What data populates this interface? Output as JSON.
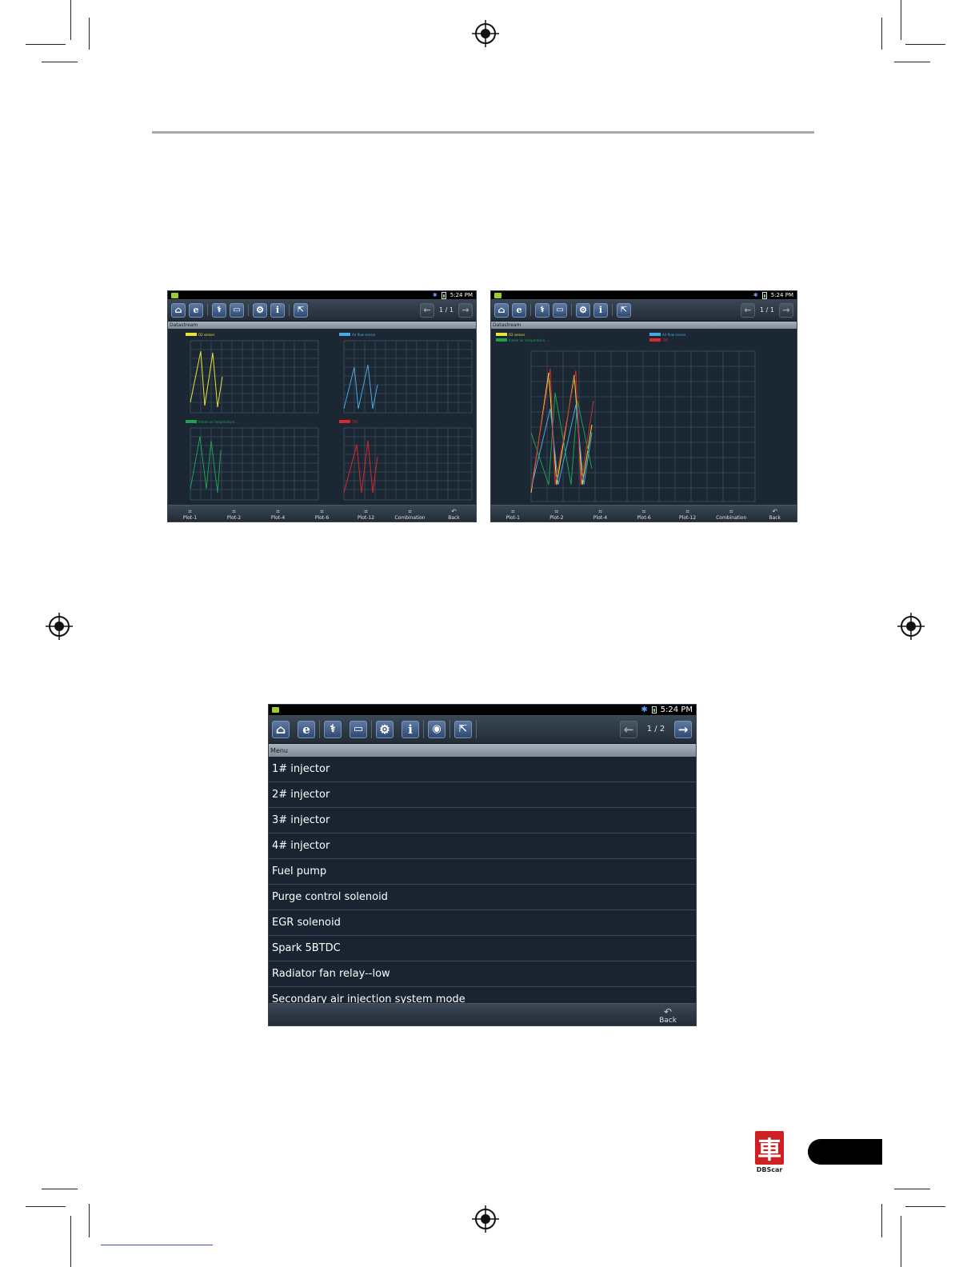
{
  "screen1": {
    "time": "5:24 PM",
    "page": "1 / 1",
    "title": "Datastream",
    "legends": [
      "O2 sensor",
      "Air flow sensor",
      "Intake air temperature...",
      "TPS"
    ],
    "bottom_buttons": [
      "Plot-1",
      "Plot-2",
      "Plot-4",
      "Plot-6",
      "Plot-12",
      "Combination",
      "Back"
    ]
  },
  "screen2": {
    "time": "5:24 PM",
    "page": "1 / 1",
    "title": "Datastream",
    "legends": [
      "O2 sensor",
      "Intake air temperature...",
      "Air flow sensor",
      "TPS"
    ],
    "bottom_buttons": [
      "Plot-1",
      "Plot-2",
      "Plot-4",
      "Plot-6",
      "Plot-12",
      "Combination",
      "Back"
    ]
  },
  "screen3": {
    "time": "5:24 PM",
    "page": "1 / 2",
    "title": "Menu",
    "items": [
      "1# injector",
      "2# injector",
      "3# injector",
      "4# injector",
      "Fuel pump",
      "Purge control solenoid",
      "EGR solenoid",
      "Spark 5BTDC",
      "Radiator fan relay--low",
      "Secondary air injection system mode"
    ],
    "back_label": "Back"
  },
  "brand": {
    "logo_char": "車",
    "name": "DBScar"
  },
  "colors": {
    "yellow": "#e8e23a",
    "blue": "#4aa8e0",
    "green": "#1fa050",
    "red": "#d8282c",
    "grid": "#4f6b80"
  },
  "icons": [
    "home-icon",
    "browser-icon",
    "diagnose-icon",
    "message-icon",
    "settings-icon",
    "info-icon",
    "camera-icon",
    "exit-icon",
    "arrow-left-icon",
    "arrow-right-icon",
    "back-icon",
    "plot-icon"
  ]
}
